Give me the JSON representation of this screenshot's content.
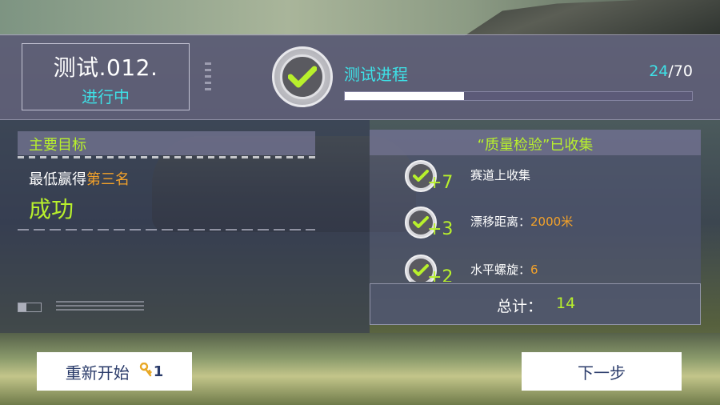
{
  "header": {
    "test_title": "测试.012.",
    "test_status": "进行中",
    "progress_label": "测试进程",
    "progress_current": "24",
    "progress_total": "70",
    "progress_fraction": 0.343
  },
  "objective": {
    "heading": "主要目标",
    "line_prefix": "最低赢得",
    "line_highlight": "第三名",
    "result": "成功"
  },
  "collected": {
    "heading": "“质量检验”已收集",
    "items": [
      {
        "points": "+7",
        "label": "赛道上收集",
        "value": ""
      },
      {
        "points": "+3",
        "label": "漂移距离：",
        "value": "2000米"
      },
      {
        "points": "+2",
        "label": "水平螺旋：",
        "value": "6"
      }
    ],
    "total_label": "总计：",
    "total_value": "14"
  },
  "buttons": {
    "restart_label": "重新开始",
    "restart_key_icon": "key-icon",
    "restart_cost": "1",
    "next_label": "下一步"
  },
  "colors": {
    "accent_green": "#b8f02c",
    "accent_cyan": "#3ee0e6",
    "accent_orange": "#f2a12a"
  }
}
